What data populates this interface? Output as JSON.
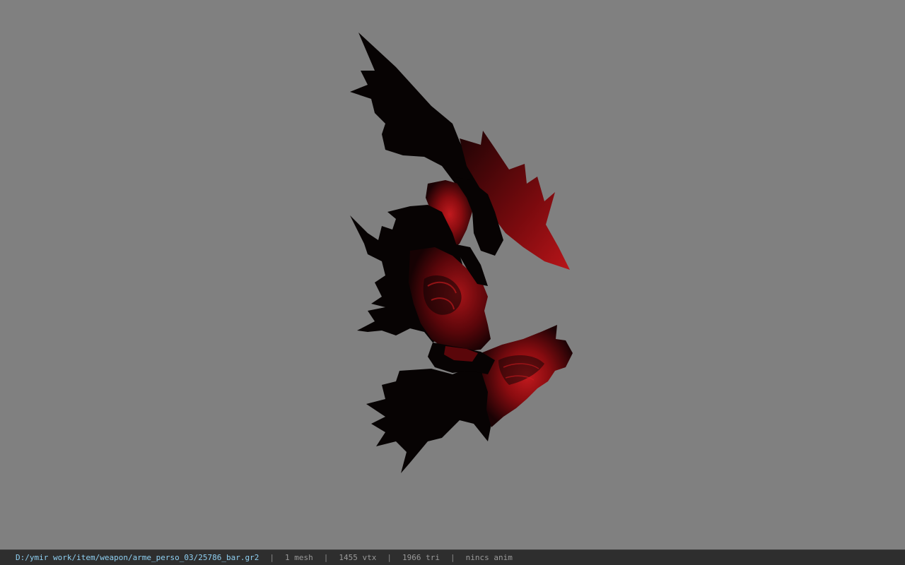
{
  "viewer": {
    "background_color": "#808080",
    "model_colors": {
      "shadow": "#070303",
      "dark_red": "#3a0406",
      "red": "#8a0c10",
      "highlight": "#c21a1e"
    }
  },
  "status_bar": {
    "file_path": "D:/ymir work/item/weapon/arme_perso_03/25786_bar.gr2",
    "separator": "|",
    "mesh_count": "1 mesh",
    "vertex_count": "1455 vtx",
    "triangle_count": "1966 tri",
    "animation": "nincs anim"
  }
}
